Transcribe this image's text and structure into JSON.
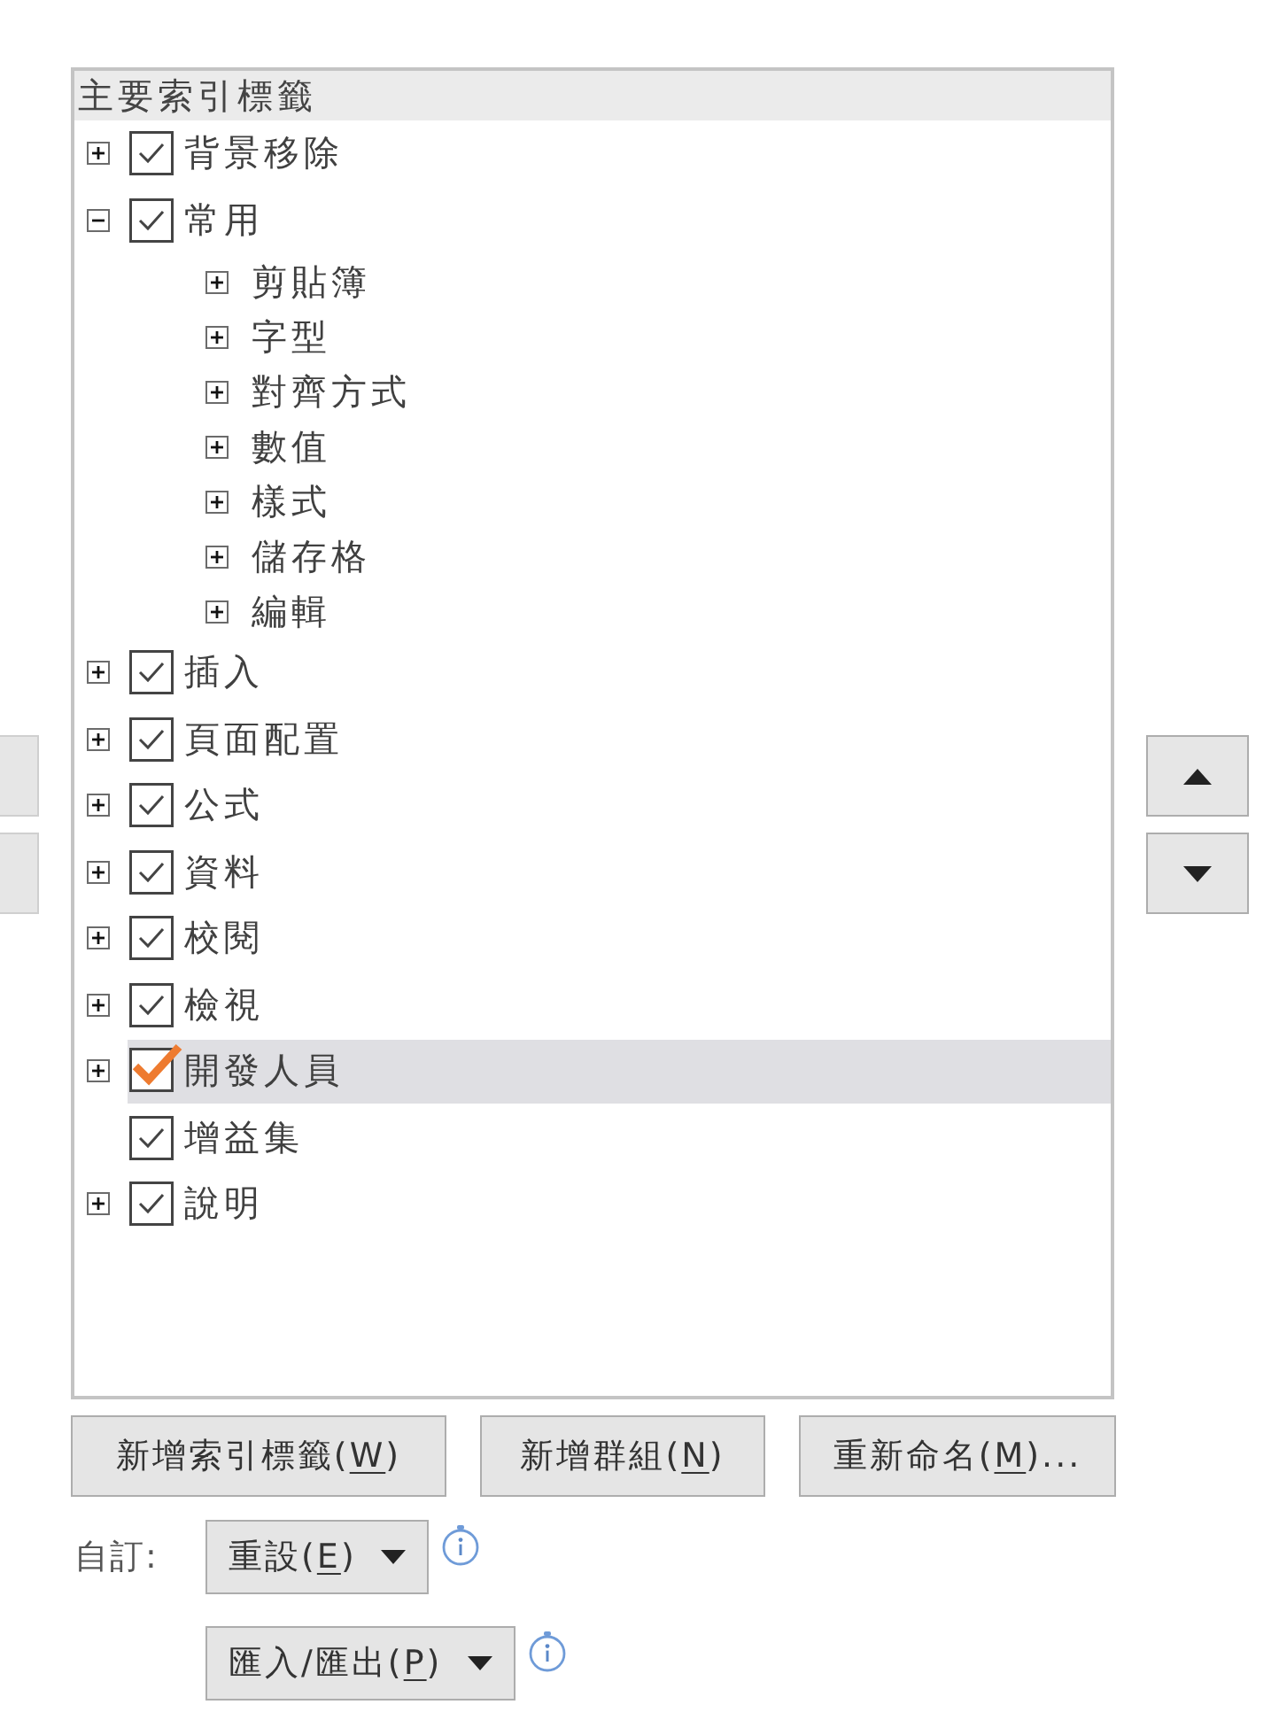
{
  "tree": {
    "header": "主要索引標籤",
    "items": [
      {
        "label": "背景移除",
        "expanded": false,
        "checked": true,
        "selected": false
      },
      {
        "label": "常用",
        "expanded": true,
        "checked": true,
        "selected": false,
        "children": [
          {
            "label": "剪貼簿",
            "expanded": false,
            "selected": false
          },
          {
            "label": "字型",
            "expanded": false,
            "selected": false
          },
          {
            "label": "對齊方式",
            "expanded": false,
            "selected": false
          },
          {
            "label": "數值",
            "expanded": false,
            "selected": false
          },
          {
            "label": "樣式",
            "expanded": false,
            "selected": false
          },
          {
            "label": "儲存格",
            "expanded": false,
            "selected": false
          },
          {
            "label": "編輯",
            "expanded": false,
            "selected": false
          }
        ]
      },
      {
        "label": "插入",
        "expanded": false,
        "checked": true,
        "selected": false
      },
      {
        "label": "頁面配置",
        "expanded": false,
        "checked": true,
        "selected": false
      },
      {
        "label": "公式",
        "expanded": false,
        "checked": true,
        "selected": false
      },
      {
        "label": "資料",
        "expanded": false,
        "checked": true,
        "selected": false
      },
      {
        "label": "校閱",
        "expanded": false,
        "checked": true,
        "selected": false
      },
      {
        "label": "檢視",
        "expanded": false,
        "checked": true,
        "selected": false
      },
      {
        "label": "開發人員",
        "expanded": false,
        "checked": true,
        "selected": true
      },
      {
        "label": "增益集",
        "checked": true,
        "selected": false
      },
      {
        "label": "說明",
        "expanded": false,
        "checked": true,
        "selected": false
      }
    ]
  },
  "actions": [
    {
      "before": "新增索引標籤(",
      "key": "W",
      "after": ")"
    },
    {
      "before": "新增群組(",
      "key": "N",
      "after": ")"
    },
    {
      "before": "重新命名(",
      "key": "M",
      "after": ")..."
    }
  ],
  "customize": {
    "label": "自訂:",
    "menus": [
      {
        "before": "重設(",
        "key": "E",
        "after": ")"
      },
      {
        "before": "匯入/匯出(",
        "key": "P",
        "after": ")"
      }
    ]
  }
}
